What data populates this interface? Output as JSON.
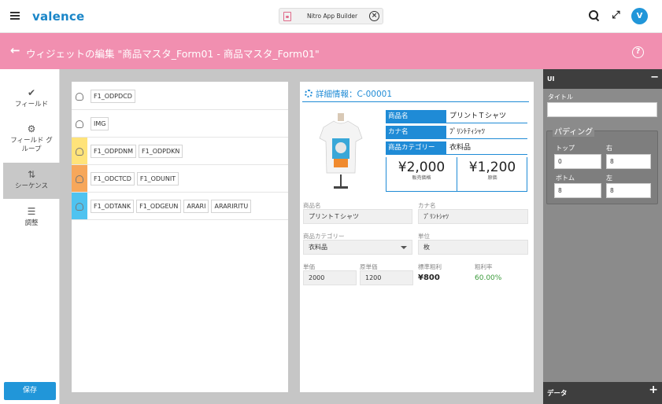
{
  "topbar": {
    "brand": "valence",
    "app_tab_title": "Nitro App Builder",
    "avatar_letter": "V"
  },
  "header": {
    "back_arrow": "←",
    "title": "ウィジェットの編集 \"商品マスタ_Form01 - 商品マスタ_Form01\"",
    "help": "?"
  },
  "leftnav": {
    "items": [
      {
        "label": "フィールド",
        "icon": "check-icon"
      },
      {
        "label": "フィールド グループ",
        "icon": "field-group-icon"
      },
      {
        "label": "シーケンス",
        "icon": "sort-arrows-icon"
      },
      {
        "label": "調整",
        "icon": "sliders-icon"
      }
    ],
    "save_label": "保存"
  },
  "sequence": {
    "rows": [
      {
        "color": "#ffffff",
        "chips": [
          "F1_ODPDCD"
        ]
      },
      {
        "color": "#ffffff",
        "chips": [
          "IMG"
        ]
      },
      {
        "color": "#ffe37a",
        "chips": [
          "F1_ODPDNM",
          "F1_ODPDKN"
        ]
      },
      {
        "color": "#f7a75a",
        "chips": [
          "F1_ODCTCD",
          "F1_ODUNIT"
        ]
      },
      {
        "color": "#4fc3f0",
        "chips": [
          "F1_ODTANK",
          "F1_ODGEUN",
          "ARARI",
          "ARARIRITU"
        ]
      }
    ]
  },
  "detail": {
    "title": "詳細情報：C-00001",
    "product_name_label": "商品名",
    "product_name_value": "プリントＴシャツ",
    "kana_label": "カナ名",
    "kana_value": "ﾌﾟﾘﾝﾄﾃｨｼｬﾂ",
    "category_label": "商品カテゴリー",
    "category_value": "衣料品",
    "sale_price": "¥2,000",
    "sale_price_label": "販売価格",
    "cost_price": "¥1,200",
    "cost_price_label": "原価",
    "form": {
      "name_label": "商品名",
      "name_value": "プリントＴシャツ",
      "kana_label": "カナ名",
      "kana_value": "ﾌﾟﾘﾝﾄｼｬﾂ",
      "category_label": "商品カテゴリー",
      "category_value": "衣料品",
      "unit_label": "単位",
      "unit_value": "枚",
      "price_label": "単価",
      "price_value": "2000",
      "cost_label": "原単価",
      "cost_value": "1200",
      "margin_label": "標準粗利",
      "margin_value": "¥800",
      "rate_label": "粗利率",
      "rate_value": "60.00%"
    }
  },
  "rightpanel": {
    "header": "UI",
    "collapse": "−",
    "title_label": "タイトル",
    "title_value": "",
    "padding_title": "パディング",
    "top_label": "トップ",
    "top_value": "0",
    "right_label": "右",
    "right_value": "8",
    "bottom_label": "ボトム",
    "bottom_value": "8",
    "left_label": "左",
    "left_value": "8",
    "footer": "データ",
    "footer_add": "+"
  }
}
